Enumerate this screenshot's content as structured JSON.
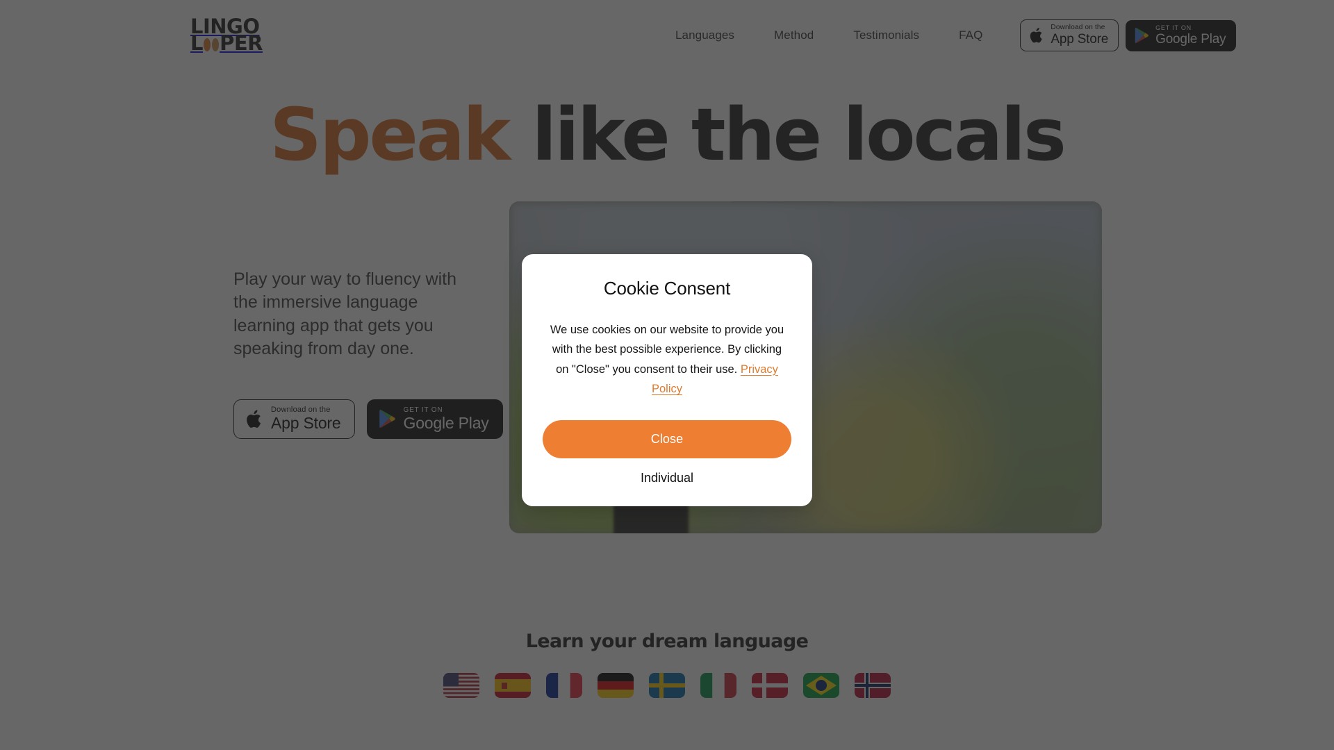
{
  "header": {
    "logo": {
      "line1": "LINGO",
      "line2_prefix": "L",
      "line2_suffix": "PER",
      "accent_color": "#e07b2e"
    },
    "nav": [
      {
        "label": "Languages"
      },
      {
        "label": "Method"
      },
      {
        "label": "Testimonials"
      },
      {
        "label": "FAQ"
      }
    ],
    "badges": {
      "apple": {
        "small": "Download on the",
        "big": "App Store",
        "icon": "apple-icon"
      },
      "google": {
        "small": "GET IT ON",
        "big": "Google Play",
        "icon": "google-play-icon"
      }
    }
  },
  "hero": {
    "title_accent": "Speak",
    "title_rest": " like the locals",
    "paragraph": "Play your way to fluency with the immersive language learning app that gets you speaking from day one.",
    "badges": {
      "apple": {
        "small": "Download on the",
        "big": "App Store",
        "icon": "apple-icon"
      },
      "google": {
        "small": "GET IT ON",
        "big": "Google Play",
        "icon": "google-play-icon"
      }
    },
    "image_alt": "Two 3D animated characters talking in a street"
  },
  "languages": {
    "title": "Learn your dream language",
    "flags": [
      {
        "name": "united-states",
        "label": "United States"
      },
      {
        "name": "spain",
        "label": "Spain"
      },
      {
        "name": "france",
        "label": "France"
      },
      {
        "name": "germany",
        "label": "Germany"
      },
      {
        "name": "sweden",
        "label": "Sweden"
      },
      {
        "name": "italy",
        "label": "Italy"
      },
      {
        "name": "denmark",
        "label": "Denmark"
      },
      {
        "name": "brazil",
        "label": "Brazil"
      },
      {
        "name": "norway",
        "label": "Norway"
      }
    ]
  },
  "cookie_modal": {
    "title": "Cookie Consent",
    "text_part1": "We use cookies on our website to provide you with the best possible experience. By clicking on \"Close\" you consent to their use. ",
    "privacy_link": "Privacy Policy",
    "close_label": "Close",
    "individual_label": "Individual",
    "accent_color": "#ee7f32"
  }
}
